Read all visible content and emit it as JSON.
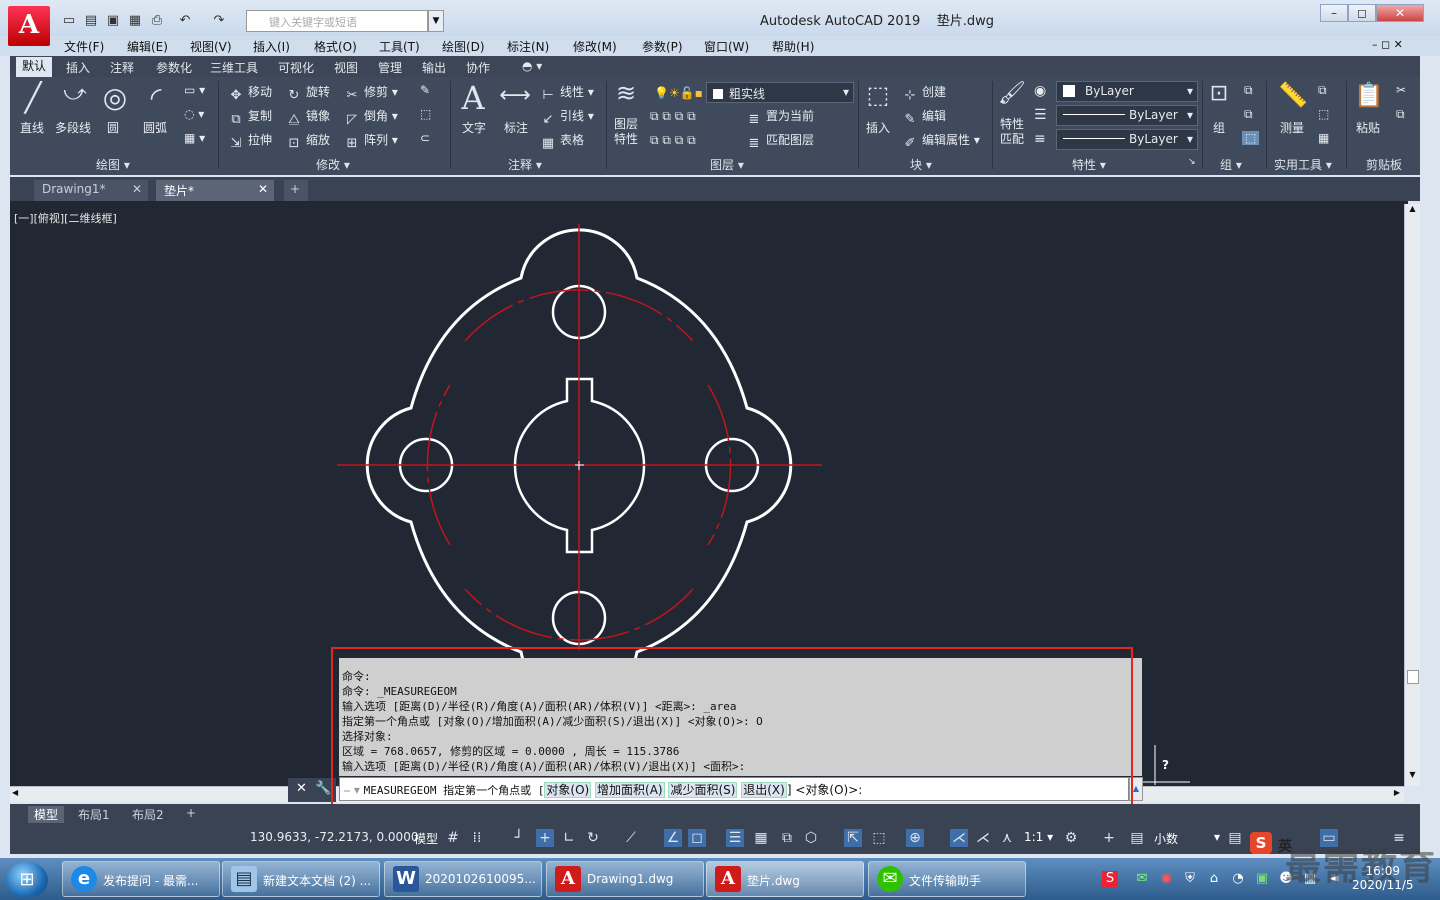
{
  "title_bar": {
    "app_title": "Autodesk AutoCAD 2019",
    "file_name": "垫片.dwg",
    "search_placeholder": "键入关键字或短语",
    "logo_letter": "A"
  },
  "menu": [
    "文件(F)",
    "编辑(E)",
    "视图(V)",
    "插入(I)",
    "格式(O)",
    "工具(T)",
    "绘图(D)",
    "标注(N)",
    "修改(M)",
    "参数(P)",
    "窗口(W)",
    "帮助(H)"
  ],
  "ribbon_tabs": [
    "默认",
    "插入",
    "注释",
    "参数化",
    "三维工具",
    "可视化",
    "视图",
    "管理",
    "输出",
    "协作"
  ],
  "ribbon": {
    "draw": {
      "line": "直线",
      "polyline": "多段线",
      "circle": "圆",
      "arc": "圆弧",
      "panel": "绘图"
    },
    "modify": {
      "move": "移动",
      "rotate": "旋转",
      "trim": "修剪",
      "copy": "复制",
      "mirror": "镜像",
      "chamfer": "倒角",
      "stretch": "拉伸",
      "scale": "缩放",
      "array": "阵列",
      "panel": "修改"
    },
    "annotation": {
      "text": "文字",
      "dimension": "标注",
      "linear": "线性",
      "leader": "引线",
      "table": "表格",
      "panel": "注释"
    },
    "layers": {
      "layer_props": "图层特性",
      "current_layer": "粗实线",
      "set_current": "置为当前",
      "match_layer": "匹配图层",
      "panel": "图层"
    },
    "block": {
      "insert": "插入",
      "create": "创建",
      "edit": "编辑",
      "edit_attr": "编辑属性",
      "panel": "块"
    },
    "properties": {
      "match": "特性匹配",
      "color": "ByLayer",
      "linetype": "ByLayer",
      "lineweight": "ByLayer",
      "panel": "特性"
    },
    "groups": {
      "group": "组",
      "panel": "组"
    },
    "utilities": {
      "measure": "测量",
      "panel": "实用工具"
    },
    "clipboard": {
      "paste": "粘贴",
      "panel": "剪贴板"
    }
  },
  "doc_tabs": [
    "Drawing1*",
    "垫片*"
  ],
  "viewport_label": "[一][俯视][二维线框]",
  "command_history": [
    "命令:",
    "命令: _MEASUREGEOM",
    "输入选项 [距离(D)/半径(R)/角度(A)/面积(AR)/体积(V)] <距离>: _area",
    "指定第一个角点或 [对象(O)/增加面积(A)/减少面积(S)/退出(X)] <对象(O)>: O",
    "选择对象:",
    "区域 = 768.0657, 修剪的区域 = 0.0000 , 周长 = 115.3786",
    "输入选项 [距离(D)/半径(R)/角度(A)/面积(AR)/体积(V)/退出(X)] <面积>:"
  ],
  "command_line": {
    "command": "MEASUREGEOM 指定第一个角点或 [",
    "opt_object": "对象(O)",
    "opt_add": "增加面积(A)",
    "opt_subtract": "减少面积(S)",
    "opt_exit": "退出(X)",
    "tail": "] <对象(O)>:"
  },
  "layout_tabs": [
    "模型",
    "布局1",
    "布局2"
  ],
  "status": {
    "coordinates": "130.9633, -72.2173, 0.0000",
    "model": "模型",
    "scale": "1:1",
    "units": "小数"
  },
  "taskbar": {
    "items": [
      {
        "label": "发布提问 - 最需...",
        "icon": "ie-icon"
      },
      {
        "label": "新建文本文档 (2) ...",
        "icon": "notepad-icon"
      },
      {
        "label": "2020102610095...",
        "icon": "word-icon"
      },
      {
        "label": "Drawing1.dwg",
        "icon": "autocad-icon"
      },
      {
        "label": "垫片.dwg",
        "icon": "autocad-icon"
      },
      {
        "label": "文件传输助手",
        "icon": "wechat-icon"
      }
    ],
    "time": "16:09",
    "date": "2020/11/5",
    "ime": "英"
  },
  "watermark": "最需教育",
  "help_mark": "?",
  "colors": {
    "drawing_bg": "#212733",
    "geometry": "#ffffff",
    "centerline": "#c0161d",
    "highlight_frame": "#e5261f"
  }
}
